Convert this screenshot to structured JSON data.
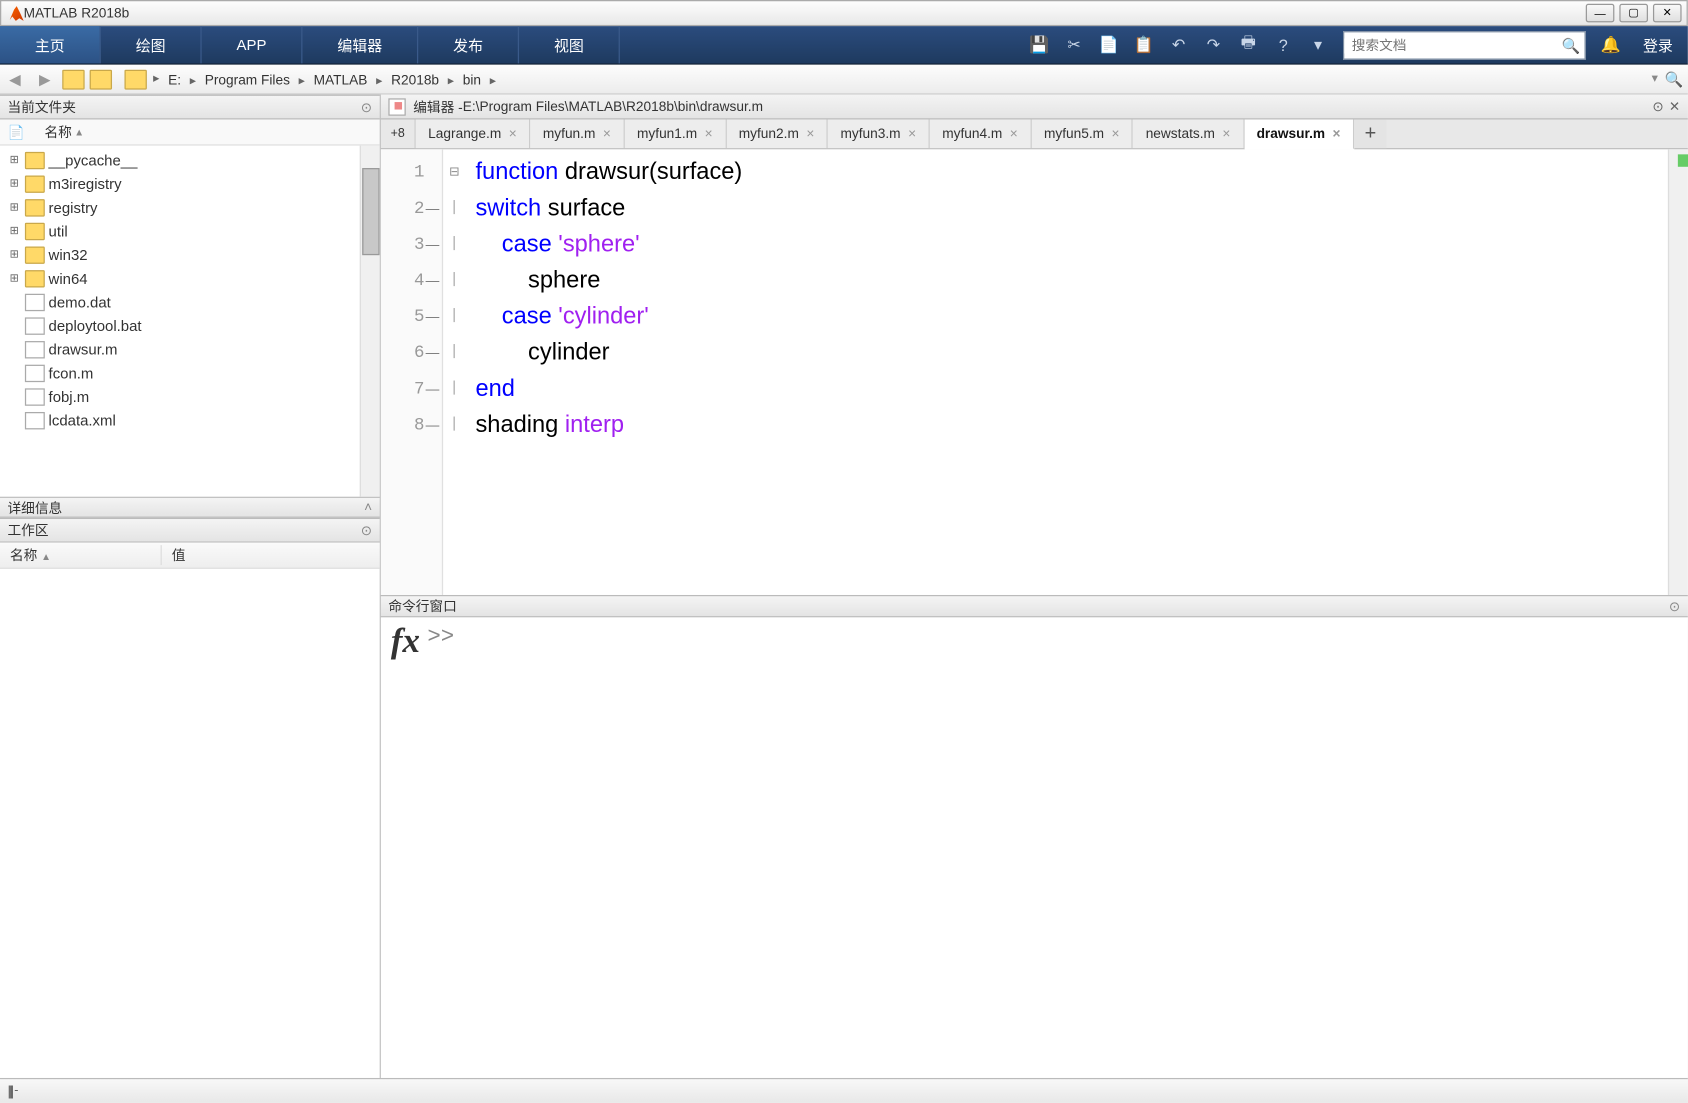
{
  "window": {
    "title": "MATLAB R2018b"
  },
  "toolstrip": {
    "tabs": [
      "主页",
      "绘图",
      "APP",
      "编辑器",
      "发布",
      "视图"
    ],
    "search_placeholder": "搜索文档",
    "login": "登录"
  },
  "address": {
    "crumbs": [
      "E:",
      "Program Files",
      "MATLAB",
      "R2018b",
      "bin"
    ]
  },
  "panels": {
    "current_folder": "当前文件夹",
    "name_col": "名称",
    "details": "详细信息",
    "workspace": "工作区",
    "ws_name": "名称",
    "ws_value": "值"
  },
  "files": [
    {
      "name": "__pycache__",
      "type": "folder",
      "exp": true
    },
    {
      "name": "m3iregistry",
      "type": "folder",
      "exp": true
    },
    {
      "name": "registry",
      "type": "folder",
      "exp": true
    },
    {
      "name": "util",
      "type": "folder",
      "exp": true
    },
    {
      "name": "win32",
      "type": "folder",
      "exp": true
    },
    {
      "name": "win64",
      "type": "folder",
      "exp": true
    },
    {
      "name": "demo.dat",
      "type": "file"
    },
    {
      "name": "deploytool.bat",
      "type": "file"
    },
    {
      "name": "drawsur.m",
      "type": "file"
    },
    {
      "name": "fcon.m",
      "type": "file"
    },
    {
      "name": "fobj.m",
      "type": "file"
    },
    {
      "name": "lcdata.xml",
      "type": "file"
    }
  ],
  "editor": {
    "header_prefix": "编辑器 - ",
    "header_path": "E:\\Program Files\\MATLAB\\R2018b\\bin\\drawsur.m",
    "scroll_badge": "+8",
    "tabs": [
      {
        "label": "Lagrange.m",
        "active": false
      },
      {
        "label": "myfun.m",
        "active": false
      },
      {
        "label": "myfun1.m",
        "active": false
      },
      {
        "label": "myfun2.m",
        "active": false
      },
      {
        "label": "myfun3.m",
        "active": false
      },
      {
        "label": "myfun4.m",
        "active": false
      },
      {
        "label": "myfun5.m",
        "active": false
      },
      {
        "label": "newstats.m",
        "active": false
      },
      {
        "label": "drawsur.m",
        "active": true
      }
    ],
    "code": [
      {
        "n": 1,
        "tokens": [
          {
            "t": "function ",
            "c": "kw"
          },
          {
            "t": "drawsur(surface)"
          }
        ]
      },
      {
        "n": 2,
        "dash": true,
        "tokens": [
          {
            "t": "switch ",
            "c": "kw"
          },
          {
            "t": "surface"
          }
        ]
      },
      {
        "n": 3,
        "dash": true,
        "tokens": [
          {
            "t": "    "
          },
          {
            "t": "case ",
            "c": "kw"
          },
          {
            "t": "'sphere'",
            "c": "str"
          }
        ]
      },
      {
        "n": 4,
        "dash": true,
        "tokens": [
          {
            "t": "        sphere"
          }
        ]
      },
      {
        "n": 5,
        "dash": true,
        "tokens": [
          {
            "t": "    "
          },
          {
            "t": "case ",
            "c": "kw"
          },
          {
            "t": "'cylinder'",
            "c": "str"
          }
        ]
      },
      {
        "n": 6,
        "dash": true,
        "tokens": [
          {
            "t": "        cylinder"
          }
        ]
      },
      {
        "n": 7,
        "dash": true,
        "tokens": [
          {
            "t": "end",
            "c": "kw"
          }
        ]
      },
      {
        "n": 8,
        "dash": true,
        "tokens": [
          {
            "t": "shading "
          },
          {
            "t": "interp",
            "c": "str"
          }
        ]
      }
    ]
  },
  "command_window": {
    "title": "命令行窗口",
    "prompt": ">>"
  },
  "statusbar": {
    "grip": "||||",
    "sep": "-"
  }
}
